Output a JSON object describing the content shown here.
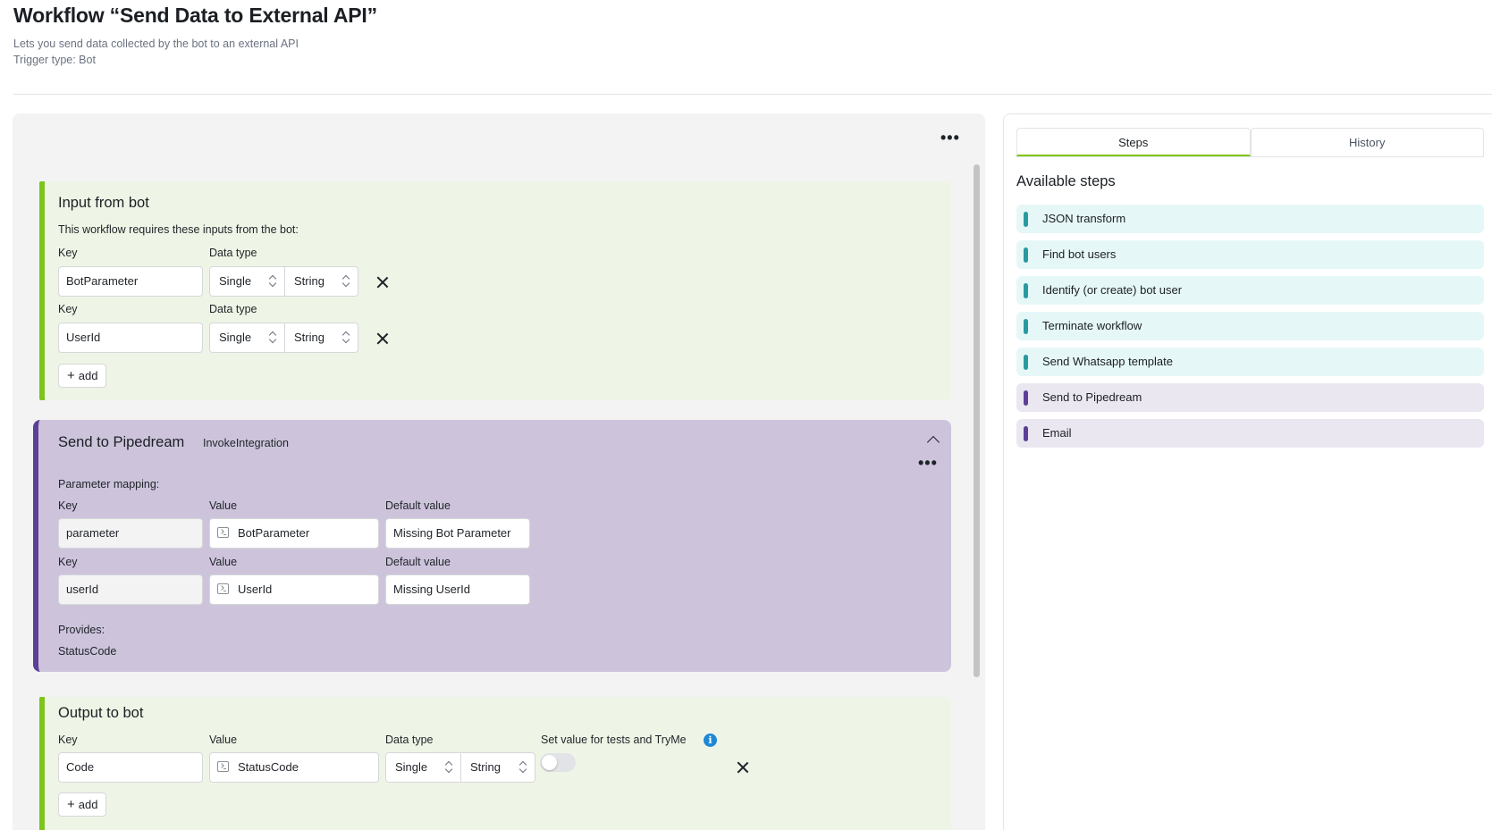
{
  "header": {
    "title": "Workflow “Send Data to External API”",
    "description": "Lets you send data collected by the bot to an external API",
    "trigger": "Trigger type: Bot"
  },
  "canvas": {
    "menu_icon": "more-horizontal-icon"
  },
  "input_card": {
    "title": "Input from bot",
    "description": "This workflow requires these inputs from the bot:",
    "key_label": "Key",
    "type_label": "Data type",
    "rows": [
      {
        "key": "BotParameter",
        "cardinality": "Single",
        "type": "String"
      },
      {
        "key": "UserId",
        "cardinality": "Single",
        "type": "String"
      }
    ],
    "add_label": "add"
  },
  "pipedream_card": {
    "title": "Send to Pipedream",
    "subtitle": "InvokeIntegration",
    "mapping_label": "Parameter mapping:",
    "key_label": "Key",
    "value_label": "Value",
    "default_label": "Default value",
    "rows": [
      {
        "key": "parameter",
        "value": "BotParameter",
        "default": "Missing Bot Parameter"
      },
      {
        "key": "userId",
        "value": "UserId",
        "default": "Missing UserId"
      }
    ],
    "provides_label": "Provides:",
    "provides_value": "StatusCode",
    "accent": "#5c3f96"
  },
  "output_card": {
    "title": "Output to bot",
    "key_label": "Key",
    "value_label": "Value",
    "type_label": "Data type",
    "test_label": "Set value for tests and TryMe",
    "row": {
      "key": "Code",
      "value": "StatusCode",
      "cardinality": "Single",
      "type": "String",
      "test_enabled": false
    },
    "add_label": "add",
    "accent": "#7cc51b"
  },
  "side_panel": {
    "tabs": [
      {
        "label": "Steps",
        "active": true
      },
      {
        "label": "History",
        "active": false
      }
    ],
    "available_title": "Available steps",
    "steps": [
      {
        "label": "JSON transform",
        "bg": "#e6f7f8",
        "bar": "#2a9aa0"
      },
      {
        "label": "Find bot users",
        "bg": "#e6f7f8",
        "bar": "#2a9aa0"
      },
      {
        "label": "Identify (or create) bot user",
        "bg": "#e6f7f8",
        "bar": "#2a9aa0"
      },
      {
        "label": "Terminate workflow",
        "bg": "#e6f7f8",
        "bar": "#2a9aa0"
      },
      {
        "label": "Send Whatsapp template",
        "bg": "#e6f7f8",
        "bar": "#2a9aa0"
      },
      {
        "label": "Send to Pipedream",
        "bg": "#ebe7f0",
        "bar": "#5c3f96"
      },
      {
        "label": "Email",
        "bg": "#ebe7f0",
        "bar": "#5c3f96"
      }
    ]
  }
}
